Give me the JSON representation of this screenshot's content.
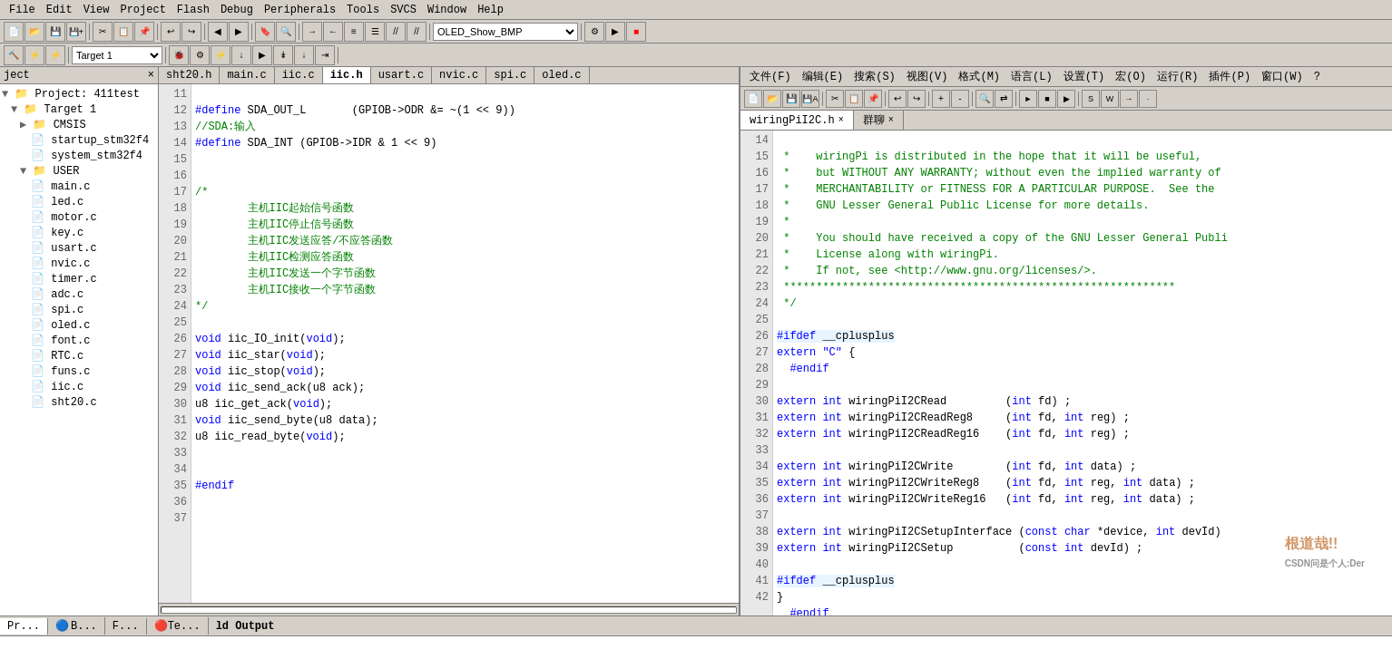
{
  "menubar": {
    "items": [
      "文件(F)",
      "编辑(E)",
      "搜索(S)",
      "视图(V)",
      "格式(M)",
      "语言(L)",
      "设置(T)",
      "宏(O)",
      "运行(R)",
      "插件(P)",
      "窗口(W)",
      "?"
    ]
  },
  "menubar_left": {
    "items": [
      "File",
      "Edit",
      "View",
      "Project",
      "Flash",
      "Debug",
      "Peripherals",
      "Tools",
      "SVCS",
      "Window",
      "Help"
    ]
  },
  "toolbar": {
    "target": "Target 1",
    "file_dropdown": "OLED_Show_BMP"
  },
  "project_panel": {
    "title": "ject",
    "items": [
      {
        "label": "Project: 411test",
        "level": 0,
        "icon": "▶"
      },
      {
        "label": "Target 1",
        "level": 1,
        "icon": "▶"
      },
      {
        "label": "CMSIS",
        "level": 2,
        "icon": "▶"
      },
      {
        "label": "startup_stm32f4",
        "level": 3,
        "icon": "📄"
      },
      {
        "label": "system_stm32f4",
        "level": 3,
        "icon": "📄"
      },
      {
        "label": "USER",
        "level": 2,
        "icon": "▶"
      },
      {
        "label": "main.c",
        "level": 3,
        "icon": "📄"
      },
      {
        "label": "led.c",
        "level": 3,
        "icon": "📄"
      },
      {
        "label": "motor.c",
        "level": 3,
        "icon": "📄"
      },
      {
        "label": "key.c",
        "level": 3,
        "icon": "📄"
      },
      {
        "label": "usart.c",
        "level": 3,
        "icon": "📄"
      },
      {
        "label": "nvic.c",
        "level": 3,
        "icon": "📄"
      },
      {
        "label": "timer.c",
        "level": 3,
        "icon": "📄"
      },
      {
        "label": "adc.c",
        "level": 3,
        "icon": "📄"
      },
      {
        "label": "spi.c",
        "level": 3,
        "icon": "📄"
      },
      {
        "label": "oled.c",
        "level": 3,
        "icon": "📄"
      },
      {
        "label": "font.c",
        "level": 3,
        "icon": "📄"
      },
      {
        "label": "RTC.c",
        "level": 3,
        "icon": "📄"
      },
      {
        "label": "funs.c",
        "level": 3,
        "icon": "📄"
      },
      {
        "label": "iic.c",
        "level": 3,
        "icon": "📄"
      },
      {
        "label": "sht20.c",
        "level": 3,
        "icon": "📄"
      }
    ]
  },
  "left_tabs": [
    "sht20.h",
    "main.c",
    "iic.c",
    "iic.h",
    "usart.c",
    "nvic.c",
    "spi.c",
    "oled.c"
  ],
  "left_active_tab": "iic.h",
  "right_tabs": [
    "wiringPiI2C.h",
    "群聊 ×"
  ],
  "right_active_tab": "wiringPiI2C.h",
  "left_code": {
    "lines": [
      {
        "n": 11,
        "code": "#define\tSDA_OUT_L\t(GPIOB->ODR &= ~(1 << 9))"
      },
      {
        "n": 12,
        "code": "//SDA:输入"
      },
      {
        "n": 13,
        "code": "#define\tSDA_INT\t(GPIOB->IDR & 1 << 9)"
      },
      {
        "n": 14,
        "code": ""
      },
      {
        "n": 15,
        "code": ""
      },
      {
        "n": 16,
        "code": "/*"
      },
      {
        "n": 17,
        "code": "\t主机IIC起始信号函数"
      },
      {
        "n": 18,
        "code": "\t主机IIC停止信号函数"
      },
      {
        "n": 19,
        "code": "\t主机IIC发送应答/不应答函数"
      },
      {
        "n": 20,
        "code": "\t主机IIC检测应答函数"
      },
      {
        "n": 21,
        "code": "\t主机IIC发送一个字节函数"
      },
      {
        "n": 22,
        "code": "\t主机IIC接收一个字节函数"
      },
      {
        "n": 23,
        "code": "*/"
      },
      {
        "n": 24,
        "code": ""
      },
      {
        "n": 25,
        "code": "void iic_IO_init(void);"
      },
      {
        "n": 26,
        "code": "void iic_star(void);"
      },
      {
        "n": 27,
        "code": "void iic_stop(void);"
      },
      {
        "n": 28,
        "code": "void iic_send_ack(u8 ack);"
      },
      {
        "n": 29,
        "code": "u8 iic_get_ack(void);"
      },
      {
        "n": 30,
        "code": "void iic_send_byte(u8 data);"
      },
      {
        "n": 31,
        "code": "u8 iic_read_byte(void);"
      },
      {
        "n": 32,
        "code": ""
      },
      {
        "n": 33,
        "code": ""
      },
      {
        "n": 34,
        "code": "#endif"
      },
      {
        "n": 35,
        "code": ""
      },
      {
        "n": 36,
        "code": ""
      },
      {
        "n": 37,
        "code": ""
      }
    ]
  },
  "right_code": {
    "lines": [
      {
        "n": 14,
        "code": " *    wiringPi is distributed in the hope that it will be useful,"
      },
      {
        "n": 15,
        "code": " *    but WITHOUT ANY WARRANTY; without even the implied warranty of"
      },
      {
        "n": 16,
        "code": " *    MERCHANTABILITY or FITNESS FOR A PARTICULAR PURPOSE.  See the"
      },
      {
        "n": 17,
        "code": " *    GNU Lesser General Public License for more details."
      },
      {
        "n": 18,
        "code": " *"
      },
      {
        "n": 19,
        "code": " *    You should have received a copy of the GNU Lesser General Publi"
      },
      {
        "n": 20,
        "code": " *    License along with wiringPi."
      },
      {
        "n": 21,
        "code": " *    If not, see <http://www.gnu.org/licenses/>."
      },
      {
        "n": 22,
        "code": " ************************************************************"
      },
      {
        "n": 23,
        "code": " */"
      },
      {
        "n": 24,
        "code": ""
      },
      {
        "n": 25,
        "code": "#ifdef __cplusplus"
      },
      {
        "n": 26,
        "code": "extern \"C\" {"
      },
      {
        "n": 27,
        "code": "  #endif"
      },
      {
        "n": 28,
        "code": ""
      },
      {
        "n": 29,
        "code": "extern int wiringPiI2CRead         (int fd) ;"
      },
      {
        "n": 30,
        "code": "extern int wiringPiI2CReadReg8     (int fd, int reg) ;"
      },
      {
        "n": 31,
        "code": "extern int wiringPiI2CReadReg16    (int fd, int reg) ;"
      },
      {
        "n": 32,
        "code": ""
      },
      {
        "n": 33,
        "code": "extern int wiringPiI2CWrite        (int fd, int data) ;"
      },
      {
        "n": 34,
        "code": "extern int wiringPiI2CWriteReg8    (int fd, int reg, int data) ;"
      },
      {
        "n": 35,
        "code": "extern int wiringPiI2CWriteReg16   (int fd, int reg, int data) ;"
      },
      {
        "n": 36,
        "code": ""
      },
      {
        "n": 37,
        "code": "extern int wiringPiI2CSetupInterface (const char *device, int devId)"
      },
      {
        "n": 38,
        "code": "extern int wiringPiI2CSetup          (const int devId) ;"
      },
      {
        "n": 39,
        "code": ""
      },
      {
        "n": 40,
        "code": "#ifdef __cplusplus"
      },
      {
        "n": 41,
        "code": "}"
      },
      {
        "n": 42,
        "code": "  #endif"
      }
    ]
  },
  "bottom": {
    "tabs": [
      "Pr...",
      "B...",
      "F...",
      "Te..."
    ],
    "output_label": "ld Output"
  },
  "watermark": "根道哉!!"
}
